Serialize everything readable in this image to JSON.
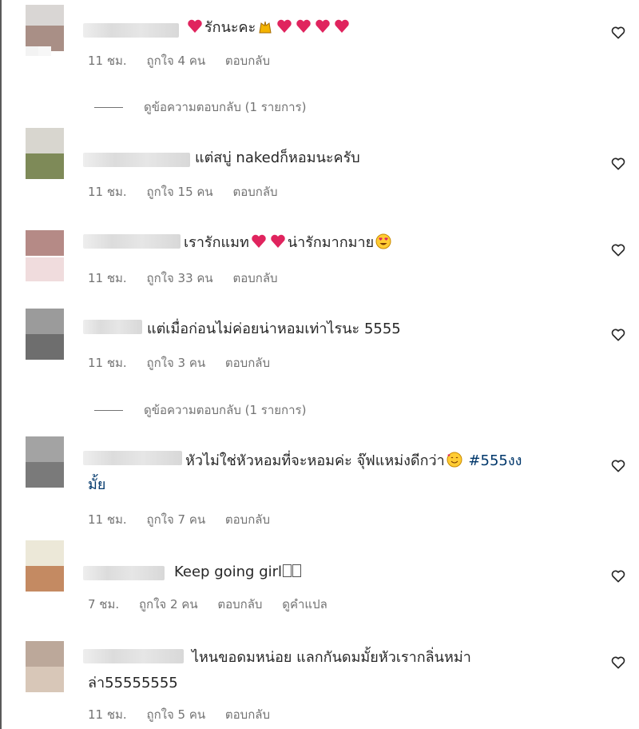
{
  "comments": [
    {
      "text_before": "",
      "text_after": "รักนะคะ",
      "text_cont": "",
      "time": "11 ชม.",
      "likes": "ถูกใจ 4 คน",
      "reply": "ตอบกลับ"
    },
    {
      "text_before": "แต่สบู่ nakedก็หอมนะครับ",
      "text_after": "",
      "text_cont": "",
      "time": "11 ชม.",
      "likes": "ถูกใจ 15 คน",
      "reply": "ตอบกลับ"
    },
    {
      "text_before": "เรารักแมท",
      "text_after": "น่ารักมากมาย",
      "text_cont": "",
      "time": "11 ชม.",
      "likes": "ถูกใจ 33 คน",
      "reply": "ตอบกลับ"
    },
    {
      "text_before": "แต่เมื่อก่อนไม่ค่อยน่าหอมเท่าไรนะ 5555",
      "text_after": "",
      "text_cont": "",
      "time": "11 ชม.",
      "likes": "ถูกใจ 3 คน",
      "reply": "ตอบกลับ"
    },
    {
      "text_before": "หัวไม่ใช่หัวหอมที่จะหอมค่ะ จุ๊ฟแหม่งดีกว่า",
      "text_after": "",
      "hashtag": "#555งง",
      "text_cont": "มั้ย",
      "time": "11 ชม.",
      "likes": "ถูกใจ 7 คน",
      "reply": "ตอบกลับ"
    },
    {
      "text_before": "Keep going girl",
      "text_after": "",
      "text_cont": "",
      "time": "7 ชม.",
      "likes": "ถูกใจ 2 คน",
      "reply": "ตอบกลับ",
      "translate": "ดูคำแปล"
    },
    {
      "text_before": "ไหนขอดมหน่อย แลกกันดมมั้ยหัวเรากลิ่นหม่า",
      "text_after": "",
      "text_cont": "ล่า55555555",
      "time": "11 ชม.",
      "likes": "ถูกใจ 5 คน",
      "reply": "ตอบกลับ"
    }
  ],
  "view_replies": [
    "ดูข้อความตอบกลับ (1 รายการ)",
    "ดูข้อความตอบกลับ (1 รายการ)"
  ],
  "icons": {
    "like": "heart-outline-icon",
    "emoji_heart": "red-heart-icon",
    "emoji_pray": "raising-hands-icon",
    "emoji_star_eyes": "heart-eyes-face-icon",
    "emoji_smile": "smiling-hearts-face-icon"
  },
  "colors": {
    "text": "#262626",
    "secondary": "#737373",
    "hashtag": "#00376b",
    "heart": "#e0245e"
  }
}
